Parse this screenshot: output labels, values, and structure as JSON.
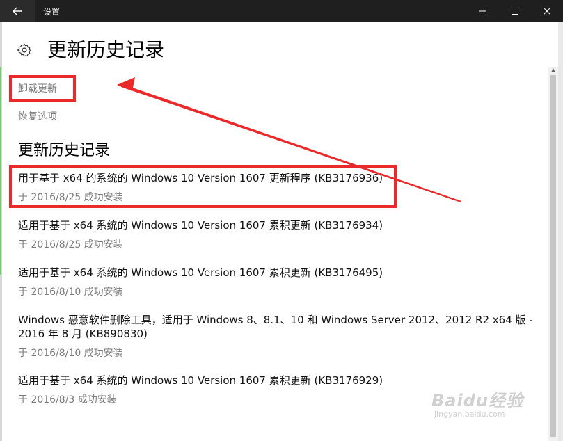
{
  "window": {
    "title": "设置",
    "back_icon": "back-arrow-icon",
    "controls": [
      "minimize-icon",
      "maximize-icon",
      "close-icon"
    ]
  },
  "page": {
    "icon": "gear-icon",
    "title": "更新历史记录"
  },
  "links": {
    "uninstall": "卸载更新",
    "recovery": "恢复选项"
  },
  "history": {
    "section_title": "更新历史记录",
    "items": [
      {
        "name": "用于基于 x64 的系统的 Windows 10 Version 1607 更新程序 (KB3176936)",
        "status": "于 2016/8/25 成功安装"
      },
      {
        "name": "适用于基于 x64 系统的 Windows 10 Version 1607 累积更新 (KB3176934)",
        "status": "于 2016/8/25 成功安装"
      },
      {
        "name": "适用于基于 x64 系统的 Windows 10 Version 1607 累积更新 (KB3176495)",
        "status": "于 2016/8/10 成功安装"
      },
      {
        "name": "Windows 恶意软件删除工具，适用于 Windows 8、8.1、10 和 Windows Server 2012、2012 R2 x64 版 - 2016 年 8 月 (KB890830)",
        "status": "于 2016/8/10 成功安装"
      },
      {
        "name": "适用于基于 x64 系统的 Windows 10 Version 1607 累积更新 (KB3176929)",
        "status": "于 2016/8/3 成功安装"
      }
    ]
  },
  "watermark": {
    "logo": "Baidu经验",
    "url": "jingyan.baidu.com"
  },
  "colors": {
    "titlebar": "#1f1f1f",
    "annotation_red": "#ea2a2a",
    "secondary_text": "#7a7a7a"
  }
}
